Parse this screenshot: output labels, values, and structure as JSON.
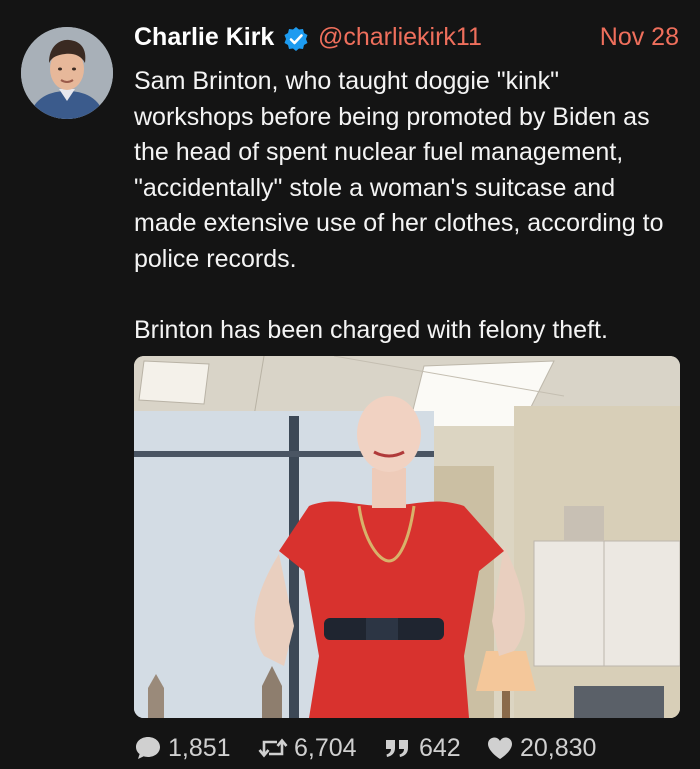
{
  "tweet": {
    "author_name": "Charlie Kirk",
    "author_handle": "@charliekirk11",
    "date": "Nov 28",
    "text": "Sam Brinton, who taught doggie \"kink\" workshops before being promoted by Biden as the head of spent nuclear fuel management, \"accidentally\" stole a woman's suitcase and made extensive use of her clothes, according to police records.\n\nBrinton has been charged with felony theft.",
    "verified": true,
    "icons": {
      "verified": "verified-badge-icon",
      "reply": "reply-icon",
      "retweet": "retweet-icon",
      "quote": "quote-icon",
      "like": "heart-icon"
    }
  },
  "stats": {
    "replies": "1,851",
    "retweets": "6,704",
    "quotes": "642",
    "likes": "20,830"
  },
  "colors": {
    "accent": "#ef6f5c",
    "background": "#141414",
    "verified": "#1d9bf0",
    "text": "#f4f4f4"
  }
}
